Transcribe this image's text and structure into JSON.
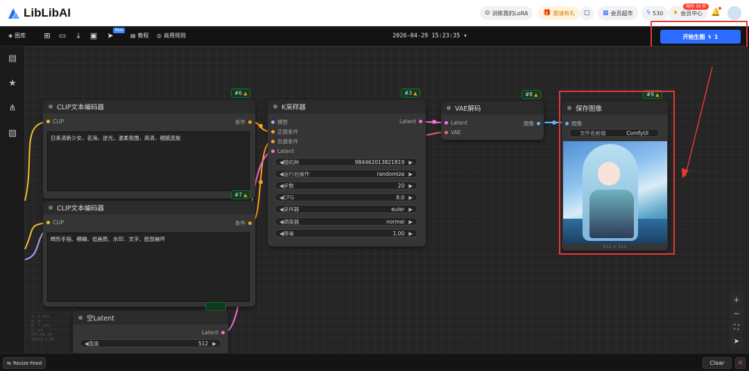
{
  "header": {
    "logo_text": "LibLibAI",
    "train_lora": "训练我的LoRA",
    "invite": "邀请有礼",
    "member_market": "会员超市",
    "credits": "530",
    "member_center": "会员中心",
    "hot_badge": "限时 39 折"
  },
  "toolbar": {
    "library": "图库",
    "new_tag": "New",
    "tutorial": "教程",
    "commercial_rules": "商用规则",
    "datetime": "2026-04-29 15:23:35",
    "generate_label": "开始生图",
    "generate_count": "1"
  },
  "nodes": {
    "clip1": {
      "id": "#6",
      "title": "CLIP文本编码器",
      "in_clip": "CLIP",
      "out_cond": "条件",
      "text": "日系清新少女，花海，逆光，温柔氛围，高清，细腻皮肤"
    },
    "clip2": {
      "id": "#7",
      "title": "CLIP文本编码器",
      "in_clip": "CLIP",
      "out_cond": "条件",
      "text": "畸形手指、模糊、低画质、水印、文字、脸部崩坏"
    },
    "ksampler": {
      "id": "#3",
      "title": "K采样器",
      "inputs": [
        "模型",
        "正面条件",
        "负面条件",
        "Latent"
      ],
      "out_latent": "Latent",
      "widgets": [
        {
          "label": "随机种",
          "value": "984462013821819"
        },
        {
          "label": "运行后操作",
          "value": "randomize"
        },
        {
          "label": "步数",
          "value": "20"
        },
        {
          "label": "CFG",
          "value": "8.0"
        },
        {
          "label": "采样器",
          "value": "euler"
        },
        {
          "label": "调度器",
          "value": "normal"
        },
        {
          "label": "降噪",
          "value": "1.00"
        }
      ]
    },
    "vae": {
      "id": "#8",
      "title": "VAE解码",
      "in_latent": "Latent",
      "in_vae": "VAE",
      "out_image": "图像"
    },
    "save": {
      "id": "#9",
      "title": "保存图像",
      "in_image": "图像",
      "prefix_label": "文件名前缀",
      "prefix_value": "ComfyUI",
      "image_size": "512 × 512"
    },
    "latent": {
      "title": "空Latent",
      "out_latent": "Latent",
      "width_label": "宽度",
      "width_value": "512"
    }
  },
  "debug_lines": [
    "T: 0.00s",
    "I: 0",
    "N: 7 [9]",
    "V: 14",
    "FPS:60.00",
    "SCALE:1.00"
  ],
  "bottom": {
    "resize_feed": "Resize Feed",
    "clear": "Clear"
  },
  "colors": {
    "accent_blue": "#2c6bff",
    "annotation_red": "#e53935",
    "wire_yellow": "#f2c02b",
    "wire_orange": "#ff9f1a",
    "wire_pink": "#ff6fd8",
    "wire_purple": "#b9a0ff",
    "wire_red": "#ff5f5f",
    "wire_blue": "#64b5f6"
  }
}
